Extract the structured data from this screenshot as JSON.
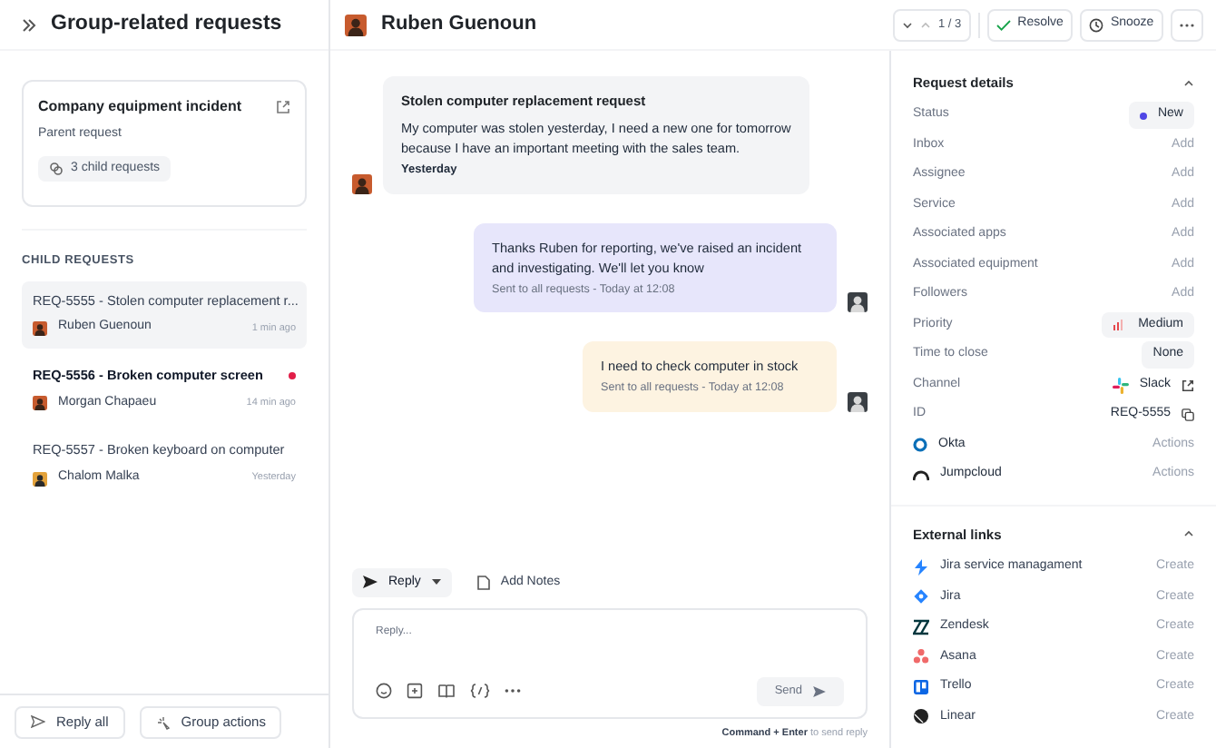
{
  "sidebar": {
    "title": "Group-related requests",
    "parent": {
      "title": "Company equipment incident",
      "subtitle": "Parent request",
      "child_count": "3 child requests"
    },
    "section_label": "CHILD REQUESTS",
    "items": [
      {
        "title": "REQ-5555 - Stolen computer replacement r...",
        "author": "Ruben Guenoun",
        "time": "1 min ago",
        "selected": true,
        "unread": false
      },
      {
        "title": "REQ-5556 - Broken computer screen",
        "author": "Morgan Chapaeu",
        "time": "14 min ago",
        "selected": false,
        "unread": true
      },
      {
        "title": "REQ-5557 - Broken keyboard on computer",
        "author": "Chalom Malka",
        "time": "Yesterday",
        "selected": false,
        "unread": false
      }
    ],
    "buttons": [
      "Reply all",
      "Group actions"
    ]
  },
  "conversation": {
    "contact": "Ruben Guenoun",
    "messages": [
      {
        "kind": "customer",
        "title": "Stolen computer replacement request",
        "body": "My computer was stolen yesterday, I need a new one for tomorrow because I have an important meeting with the sales team.",
        "meta": "Yesterday"
      },
      {
        "kind": "reply",
        "body": "Thanks Ruben for reporting, we've raised an incident and investigating. We'll let you know",
        "meta": "Sent to all requests - Today at 12:08"
      },
      {
        "kind": "note",
        "body": "I need to check computer in stock",
        "meta": "Sent to all requests - Today at 12:08"
      }
    ],
    "composer": {
      "tabs": [
        {
          "label": "Reply",
          "selected": true
        },
        {
          "label": "Add Notes",
          "selected": false
        }
      ],
      "placeholder": "Reply...",
      "send": "Send",
      "send_disabled": true,
      "hint": "**Command + Enter** to send reply"
    }
  },
  "toolbar": {
    "pager": "1 / 3",
    "buttons": [
      "Resolve",
      "Snooze"
    ]
  },
  "details": {
    "title": "Request details",
    "expanded": true,
    "rows": [
      {
        "kind": "badge",
        "label": "Status",
        "value": "New",
        "color": "#4f46e5"
      },
      {
        "kind": "add",
        "label": "Inbox",
        "value": "Add"
      },
      {
        "kind": "add",
        "label": "Assignee",
        "value": "Add"
      },
      {
        "kind": "add",
        "label": "Service",
        "value": "Add"
      },
      {
        "kind": "add",
        "label": "Associated apps",
        "value": "Add"
      },
      {
        "kind": "add",
        "label": "Associated equipment",
        "value": "Add"
      },
      {
        "kind": "add",
        "label": "Followers",
        "value": "Add"
      },
      {
        "kind": "priority",
        "label": "Priority",
        "value": "Medium"
      },
      {
        "kind": "plain-badge",
        "label": "Time to close",
        "value": "None"
      },
      {
        "kind": "channel",
        "label": "Channel",
        "value": "Slack"
      },
      {
        "kind": "id",
        "label": "ID",
        "value": "REQ-5555"
      },
      {
        "kind": "app",
        "label": "Okta",
        "value": "Actions"
      },
      {
        "kind": "app",
        "label": "Jumpcloud",
        "value": "Actions"
      }
    ]
  },
  "external_links": {
    "title": "External links",
    "expanded": true,
    "items": [
      {
        "name": "Jira service managament",
        "action": "Create"
      },
      {
        "name": "Jira",
        "action": "Create"
      },
      {
        "name": "Zendesk",
        "action": "Create"
      },
      {
        "name": "Asana",
        "action": "Create"
      },
      {
        "name": "Trello",
        "action": "Create"
      },
      {
        "name": "Linear",
        "action": "Create"
      }
    ]
  }
}
